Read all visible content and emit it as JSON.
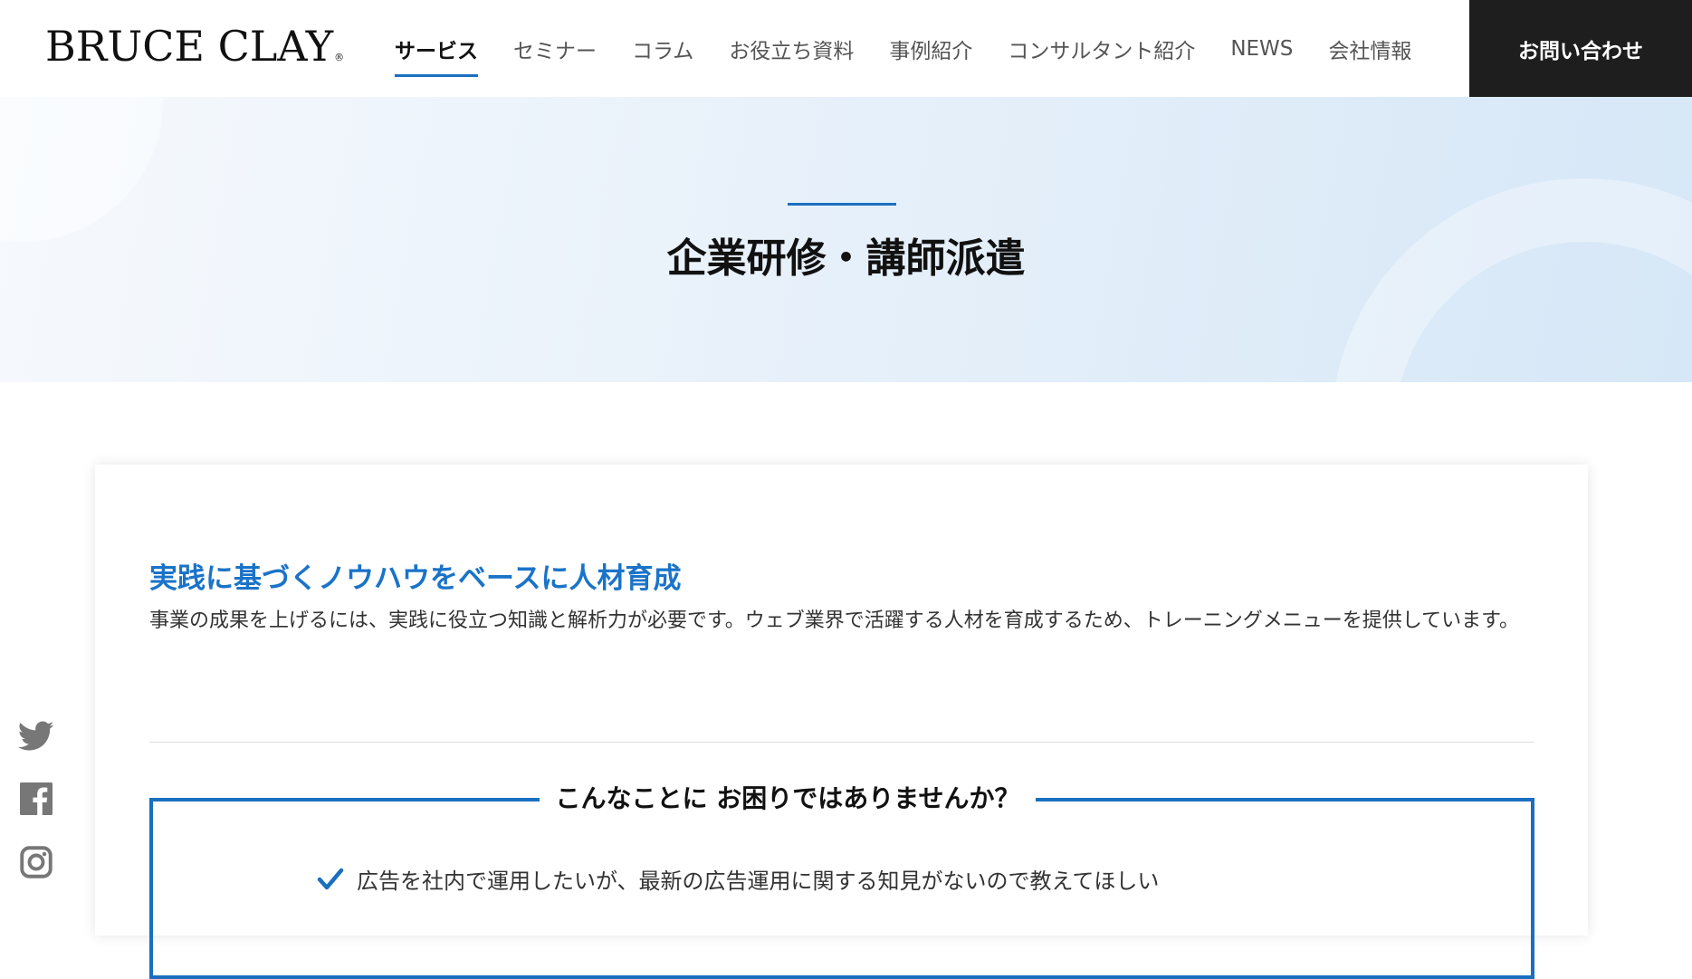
{
  "header": {
    "logo": {
      "text": "BRUCE CLAY",
      "mark": "®"
    },
    "nav": [
      {
        "label": "サービス",
        "active": true
      },
      {
        "label": "セミナー",
        "active": false
      },
      {
        "label": "コラム",
        "active": false
      },
      {
        "label": "お役立ち資料",
        "active": false
      },
      {
        "label": "事例紹介",
        "active": false
      },
      {
        "label": "コンサルタント紹介",
        "active": false
      },
      {
        "label": "NEWS",
        "active": false
      },
      {
        "label": "会社情報",
        "active": false
      }
    ],
    "contact_label": "お問い合わせ"
  },
  "hero": {
    "title": "企業研修・講師派遣"
  },
  "main": {
    "heading": "実践に基づくノウハウをベースに人材育成",
    "description": "事業の成果を上げるには、実践に役立つ知識と解析力が必要です。ウェブ業界で活躍する人材を育成するため、トレーニングメニューを提供しています。",
    "problems_title": "こんなことに お困りではありませんか？",
    "problems": [
      "広告を社内で運用したいが、最新の広告運用に関する知見がないので教えてほしい"
    ]
  },
  "social": [
    {
      "icon": "twitter-icon"
    },
    {
      "icon": "facebook-icon"
    },
    {
      "icon": "instagram-icon"
    }
  ],
  "colors": {
    "accent": "#1a6fbf",
    "heading_blue": "#1a73c8",
    "contact_bg": "#1e1e1e",
    "social_gray": "#777777"
  }
}
